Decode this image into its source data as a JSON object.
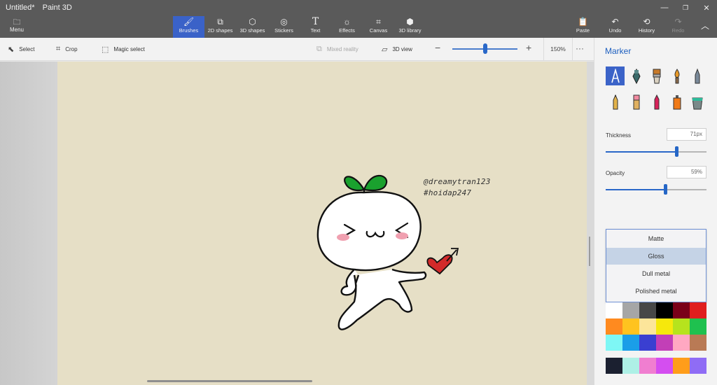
{
  "window": {
    "title": "Untitled*",
    "app_name": "Paint 3D",
    "controls": [
      "minimize-icon",
      "maximize-icon",
      "close-icon"
    ]
  },
  "ribbon": {
    "menu_label": "Menu",
    "tools": [
      {
        "label": "Brushes",
        "icon": "brush-icon",
        "active": true
      },
      {
        "label": "2D shapes",
        "icon": "2d-shapes-icon"
      },
      {
        "label": "3D shapes",
        "icon": "3d-shapes-icon"
      },
      {
        "label": "Stickers",
        "icon": "stickers-icon"
      },
      {
        "label": "Text",
        "icon": "text-icon"
      },
      {
        "label": "Effects",
        "icon": "effects-icon"
      },
      {
        "label": "Canvas",
        "icon": "canvas-icon"
      },
      {
        "label": "3D library",
        "icon": "3d-library-icon"
      }
    ],
    "right_tools": [
      {
        "label": "Paste",
        "icon": "paste-icon"
      },
      {
        "label": "Undo",
        "icon": "undo-icon"
      },
      {
        "label": "History",
        "icon": "history-icon"
      },
      {
        "label": "Redo",
        "icon": "redo-icon",
        "disabled": true
      }
    ],
    "collapse_icon": "chevron-up-icon"
  },
  "toolbar": {
    "select": "Select",
    "crop": "Crop",
    "magic_select": "Magic select",
    "mixed_reality": "Mixed reality",
    "view_3d": "3D view",
    "zoom": "150%",
    "zoom_fraction": 0.5,
    "more": "···"
  },
  "canvas": {
    "watermark_line1": "@dreamytran123",
    "watermark_line2": "#hoidap247",
    "background": "#e6dfc6"
  },
  "panel": {
    "title": "Marker",
    "brushes": [
      "marker-icon",
      "calligraphy-pen-icon",
      "oil-brush-icon",
      "watercolor-icon",
      "pixel-pen-icon",
      "pencil-icon",
      "eraser-icon",
      "crayon-icon",
      "spray-can-icon",
      "fill-bucket-icon"
    ],
    "thickness_label": "Thickness",
    "thickness_value": "71px",
    "thickness_fraction": 0.7,
    "opacity_label": "Opacity",
    "opacity_value": "59%",
    "opacity_fraction": 0.59,
    "finish_options": [
      "Matte",
      "Gloss",
      "Dull metal",
      "Polished metal"
    ],
    "finish_selected": "Gloss",
    "palette": [
      "#ffffff",
      "#a6a6a6",
      "#474747",
      "#000000",
      "#7a0019",
      "#e01e1e",
      "#ff8a1f",
      "#ffc31f",
      "#fce59a",
      "#f6e80c",
      "#b6e31d",
      "#1fc14f",
      "#7ef7f5",
      "#1a9ee8",
      "#3a3fd1",
      "#c23fb7",
      "#ffa8c2",
      "#b97a55",
      "#1b2030",
      "#aef0e6",
      "#f07ed0",
      "#d44ef0",
      "#ff9d1a",
      "#8f6cf5"
    ],
    "accent_color": "#3b63c8"
  }
}
